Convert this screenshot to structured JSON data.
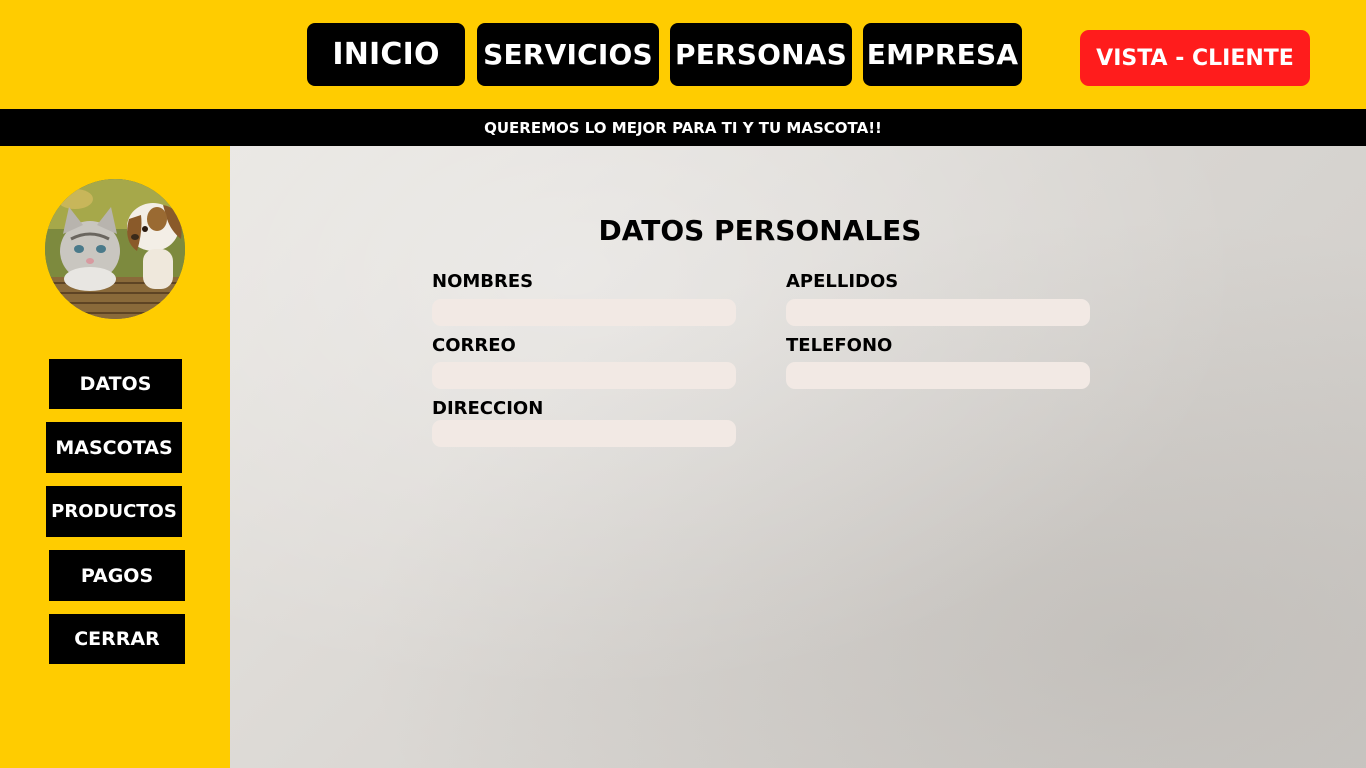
{
  "header": {
    "nav": [
      {
        "label": "INICIO"
      },
      {
        "label": "SERVICIOS"
      },
      {
        "label": "PERSONAS"
      },
      {
        "label": "EMPRESA"
      }
    ],
    "vista_button": "VISTA - CLIENTE"
  },
  "banner": {
    "text": "QUEREMOS LO MEJOR PARA TI Y TU MASCOTA!!"
  },
  "sidebar": {
    "avatar_icon": "pet-photo-icon",
    "items": [
      {
        "label": "DATOS"
      },
      {
        "label": "MASCOTAS"
      },
      {
        "label": "PRODUCTOS"
      },
      {
        "label": "PAGOS"
      },
      {
        "label": "CERRAR"
      }
    ]
  },
  "form": {
    "title": "DATOS PERSONALES",
    "fields": {
      "nombres": {
        "label": "NOMBRES",
        "value": ""
      },
      "apellidos": {
        "label": "APELLIDOS",
        "value": ""
      },
      "correo": {
        "label": "CORREO",
        "value": ""
      },
      "telefono": {
        "label": "TELEFONO",
        "value": ""
      },
      "direccion": {
        "label": "DIRECCION",
        "value": ""
      }
    }
  },
  "colors": {
    "primary_yellow": "#ffcc00",
    "black": "#000000",
    "accent_red": "#ff1c1c",
    "input_bg": "#f2e9e4"
  }
}
